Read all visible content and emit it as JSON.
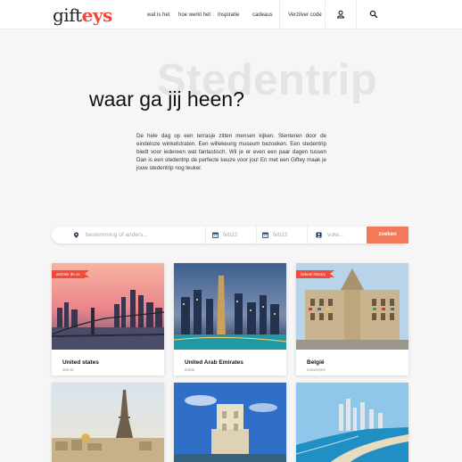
{
  "header": {
    "logo_part1": "gift",
    "logo_part2": "eys",
    "nav": [
      "wat is het",
      "hoe werkt het",
      "Inspiratie",
      "cadeaus"
    ],
    "verzilver": "Verzilver code",
    "user_icon": "user-icon",
    "search_icon": "search-icon",
    "accent_color": "#f04a3a"
  },
  "hero": {
    "bg_word": "Stedentrip",
    "title": "waar ga jij heen?",
    "text": "De hele dag op een terrasje zitten mensen kijken. Slenteren door de eindeloze winkelstraten. Een willekeurig museum bezoeken. Een stedentrip biedt voor iedereen wat fantastisch. Wil je er even een paar dagen tussen Dan is een stedentrip de perfecte keuze voor jou! En met een Giftey maak je jouw stedentrip nog leuker."
  },
  "search": {
    "destination_placeholder": "bestemming of anders...",
    "date_from": "feb22",
    "date_to": "feb23",
    "guests": "volw...",
    "button": "zoeken",
    "button_color": "#f27a5a"
  },
  "cards": [
    {
      "name": "United states",
      "sub": "detroit",
      "badge": "ambiek de vs"
    },
    {
      "name": "United Arab Emirates",
      "sub": "dubai",
      "badge": ""
    },
    {
      "name": "België",
      "sub": "antwerpen",
      "badge": "bekeel history"
    },
    {
      "name": "",
      "sub": "",
      "badge": ""
    },
    {
      "name": "",
      "sub": "",
      "badge": ""
    },
    {
      "name": "",
      "sub": "",
      "badge": ""
    }
  ]
}
